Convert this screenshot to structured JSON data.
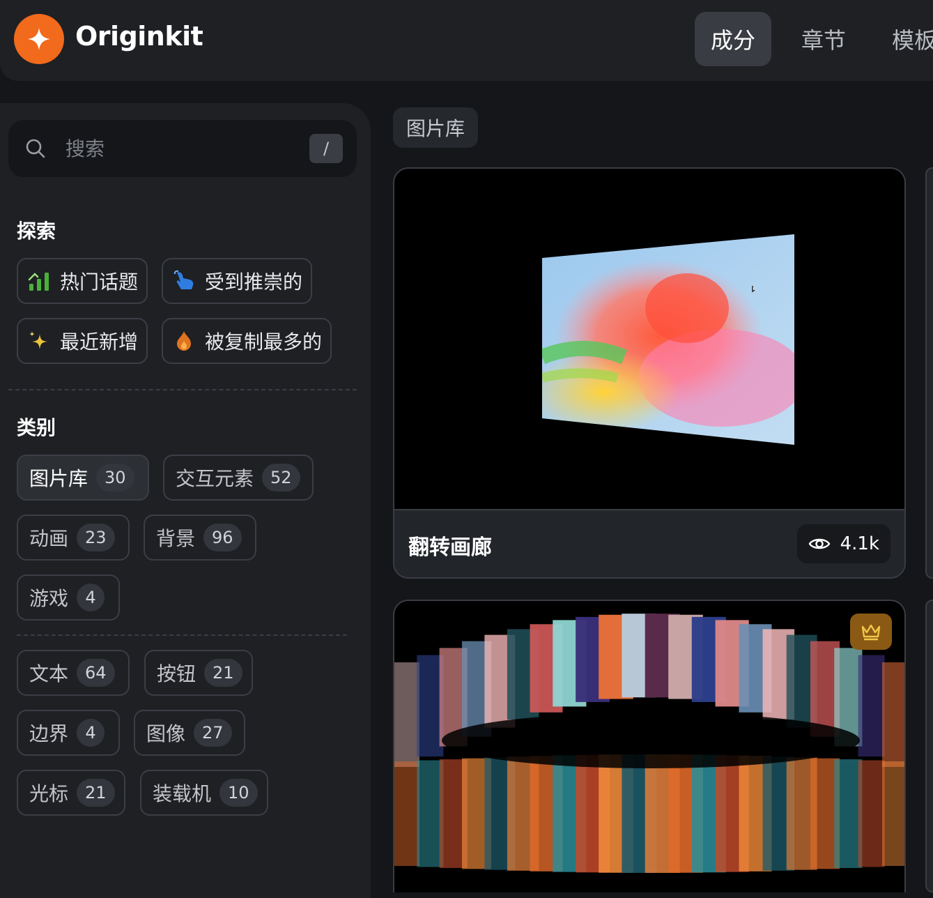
{
  "header": {
    "brand": "Originkit",
    "tabs": [
      {
        "label": "成分",
        "active": true
      },
      {
        "label": "章节",
        "active": false
      },
      {
        "label": "模板",
        "active": false
      }
    ]
  },
  "sidebar": {
    "search": {
      "placeholder": "搜索",
      "shortcut": "/"
    },
    "explore": {
      "title": "探索",
      "items": [
        {
          "label": "热门话题",
          "icon": "trending-bars-icon"
        },
        {
          "label": "受到推崇的",
          "icon": "pointing-hand-icon"
        },
        {
          "label": "最近新增",
          "icon": "sparkles-icon"
        },
        {
          "label": "被复制最多的",
          "icon": "flame-icon"
        }
      ]
    },
    "categories": {
      "title": "类别",
      "items": [
        {
          "label": "图片库",
          "count": "30",
          "active": true
        },
        {
          "label": "交互元素",
          "count": "52"
        },
        {
          "label": "动画",
          "count": "23"
        },
        {
          "label": "背景",
          "count": "96"
        },
        {
          "label": "游戏",
          "count": "4"
        },
        {
          "label": "文本",
          "count": "64"
        },
        {
          "label": "按钮",
          "count": "21"
        },
        {
          "label": "边界",
          "count": "4"
        },
        {
          "label": "图像",
          "count": "27"
        },
        {
          "label": "光标",
          "count": "21"
        },
        {
          "label": "装载机",
          "count": "10"
        }
      ]
    }
  },
  "main": {
    "tag": "图片库",
    "cards": [
      {
        "title": "翻转画廊",
        "views": "4.1k",
        "premium": false
      },
      {
        "title": "",
        "views": "",
        "premium": true,
        "badge_icon": "crown-icon"
      }
    ]
  },
  "colors": {
    "accent": "#f26a1b",
    "background": "#141619",
    "panel": "#1e2024",
    "premium": "#8a5a14"
  }
}
